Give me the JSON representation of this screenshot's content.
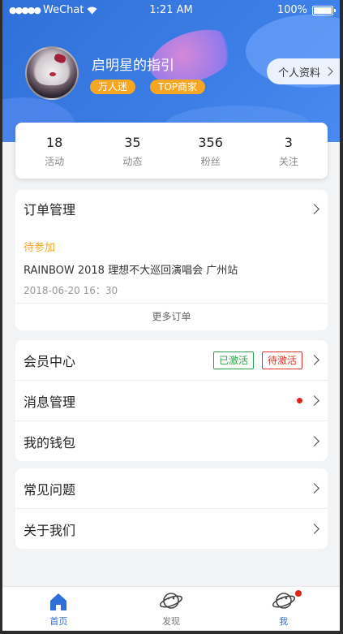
{
  "status_bar": {
    "carrier": "WeChat",
    "time": "1:21 AM",
    "battery": "100%"
  },
  "profile": {
    "name": "启明星的指引",
    "tags": [
      "万人迷",
      "TOP商家"
    ],
    "profile_button": "个人资料"
  },
  "stats": [
    {
      "value": "18",
      "label": "活动"
    },
    {
      "value": "35",
      "label": "动态"
    },
    {
      "value": "356",
      "label": "粉丝"
    },
    {
      "value": "3",
      "label": "关注"
    }
  ],
  "orders": {
    "title": "订单管理",
    "status": "待参加",
    "event_title": "RAINBOW 2018 理想不大巡回演唱会 广州站",
    "event_time": "2018-06-20 16：30",
    "more": "更多订单"
  },
  "member_menu": {
    "member_center": "会员中心",
    "badge_active": "已激活",
    "badge_pending": "待激活",
    "messages": "消息管理",
    "wallet": "我的钱包"
  },
  "help_menu": {
    "faq": "常见问题",
    "about": "关于我们"
  },
  "tabbar": [
    {
      "label": "首页",
      "icon": "home-icon",
      "active": true
    },
    {
      "label": "发现",
      "icon": "planet-icon",
      "active": false
    },
    {
      "label": "我",
      "icon": "planet-icon",
      "active": false
    }
  ],
  "colors": {
    "primary": "#2f6fd9",
    "accent": "#f5a623",
    "active_badge": "#2aa44a",
    "pending_badge": "#e0342a"
  }
}
